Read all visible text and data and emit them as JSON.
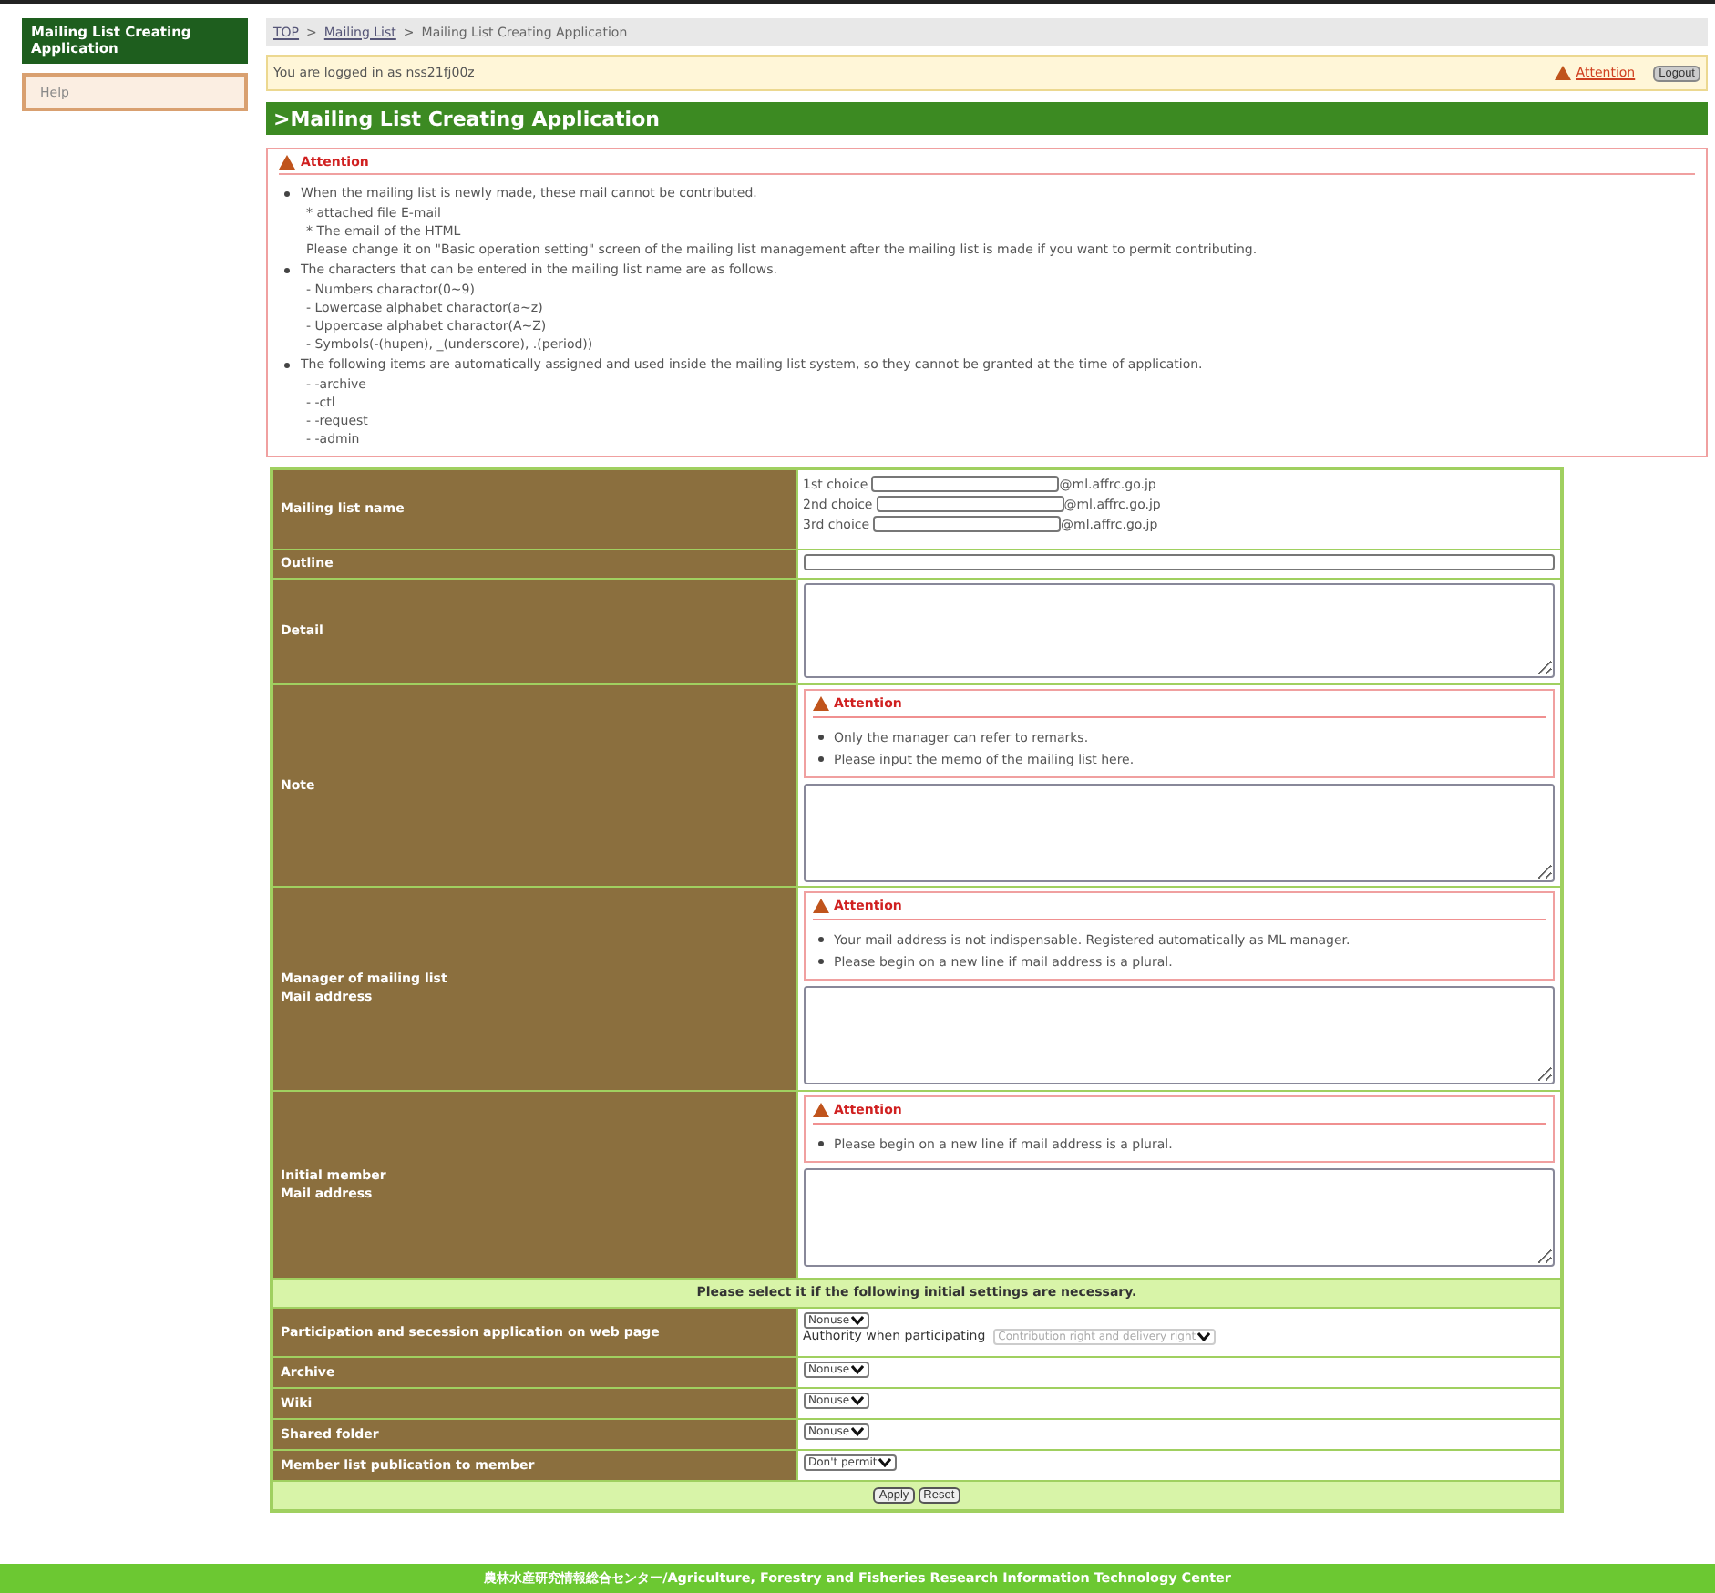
{
  "sidebar": {
    "title": "Mailing List Creating Application",
    "items": [
      {
        "label": "Help"
      }
    ]
  },
  "breadcrumb": [
    {
      "label": "TOP",
      "kind": "link"
    },
    {
      "label": ">",
      "kind": "text"
    },
    {
      "label": "Mailing List",
      "kind": "link"
    },
    {
      "label": ">",
      "kind": "text"
    },
    {
      "label": "Mailing List Creating Application",
      "kind": "text"
    }
  ],
  "login_bar": {
    "text": "You are logged in as nss21fj00z",
    "attention_link": "Attention",
    "logout_button": "Logout"
  },
  "page_title": ">Mailing List Creating Application",
  "attention": {
    "title": "Attention",
    "items": [
      {
        "text": "When the mailing list is newly made, these mail cannot be contributed.",
        "sub": [
          "* attached file E-mail",
          "* The email of the HTML",
          "Please change it on \"Basic operation setting\" screen of the mailing list management after the mailing list is made if you want to permit contributing."
        ]
      },
      {
        "text": "The characters that can be entered in the mailing list name are as follows.",
        "sub": [
          "- Numbers charactor(0~9)",
          "- Lowercase alphabet charactor(a~z)",
          "- Uppercase alphabet charactor(A~Z)",
          "- Symbols(-(hupen), _(underscore), .(period))"
        ]
      },
      {
        "text": "The following items are automatically assigned and used inside the mailing list system, so they cannot be granted at the time of application.",
        "sub": [
          "- -archive",
          "- -ctl",
          "- -request",
          "- -admin"
        ]
      }
    ]
  },
  "form": [
    {
      "kind": "choices",
      "label_lines": [
        "Mailing list name"
      ],
      "choices": [
        {
          "label": "1st choice",
          "suffix": "@ml.affrc.go.jp"
        },
        {
          "label": "2nd choice",
          "suffix": "@ml.affrc.go.jp"
        },
        {
          "label": "3rd choice",
          "suffix": "@ml.affrc.go.jp"
        }
      ]
    },
    {
      "kind": "input",
      "label_lines": [
        "Outline"
      ]
    },
    {
      "kind": "textarea",
      "label_lines": [
        "Detail"
      ]
    },
    {
      "kind": "note",
      "label_lines": [
        "Note"
      ],
      "attention": {
        "title": "Attention",
        "items": [
          "Only the manager can refer to remarks.",
          "Please input the memo of the mailing list here."
        ]
      }
    },
    {
      "kind": "note",
      "label_lines": [
        "Manager of mailing list",
        "Mail address"
      ],
      "attention": {
        "title": "Attention",
        "items": [
          "Your mail address is not indispensable. Registered automatically as ML manager.",
          "Please begin on a new line if mail address is a plural."
        ]
      }
    },
    {
      "kind": "note",
      "label_lines": [
        "Initial member",
        "Mail address"
      ],
      "attention": {
        "title": "Attention",
        "items": [
          "Please begin on a new line if mail address is a plural."
        ]
      }
    }
  ],
  "settings_heading": "Please select it if the following initial settings are necessary.",
  "settings": [
    {
      "label": "Participation and secession application on web page",
      "value": "Nonuse",
      "extra": {
        "label": "Authority when participating",
        "value": "Contribution right and delivery right",
        "disabled": true
      }
    },
    {
      "label": "Archive",
      "value": "Nonuse"
    },
    {
      "label": "Wiki",
      "value": "Nonuse"
    },
    {
      "label": "Shared folder",
      "value": "Nonuse"
    },
    {
      "label": "Member list publication to member",
      "value": "Don't permit"
    }
  ],
  "buttons": [
    "Apply",
    "Reset"
  ],
  "footer": "農林水産研究情報総合センター/Agriculture, Forestry and Fisheries Research Information Technology Center"
}
